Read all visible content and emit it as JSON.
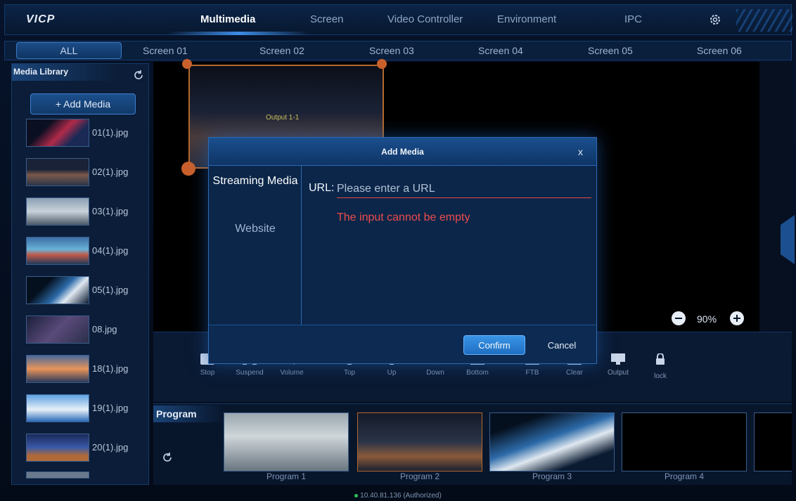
{
  "app": {
    "logo": "VICP"
  },
  "top_tabs": [
    {
      "label": "Multimedia",
      "active": true
    },
    {
      "label": "Screen"
    },
    {
      "label": "Video Controller"
    },
    {
      "label": "Environment"
    },
    {
      "label": "IPC"
    }
  ],
  "screen_tabs": [
    "ALL",
    "Screen 01",
    "Screen 02",
    "Screen 03",
    "Screen 04",
    "Screen 05",
    "Screen 06"
  ],
  "library": {
    "title": "Media Library",
    "add_label": "+ Add Media",
    "items": [
      "01(1).jpg",
      "02(1).jpg",
      "03(1).jpg",
      "04(1).jpg",
      "05(1).jpg",
      "08.jpg",
      "18(1).jpg",
      "19(1).jpg",
      "20(1).jpg"
    ]
  },
  "canvas": {
    "output_label": "Output 1-1",
    "zoom": "90%"
  },
  "toolbar": [
    "Stop",
    "Suspend",
    "Volume",
    "Top",
    "Up",
    "Down",
    "Bottom",
    "FTB",
    "Clear",
    "Output",
    "lock"
  ],
  "program": {
    "title": "Program",
    "items": [
      "Program 1",
      "Program 2",
      "Program 3",
      "Program 4"
    ]
  },
  "status": "10.40.81.136 (Authorized)",
  "modal": {
    "title": "Add Media",
    "close": "x",
    "nav": [
      "Streaming Media",
      "Website"
    ],
    "url_label": "URL:",
    "url_placeholder": "Please enter a URL",
    "url_value": "",
    "error": "The input cannot be empty",
    "confirm": "Confirm",
    "cancel": "Cancel"
  },
  "colors": {
    "accent": "#3a94e6",
    "error": "#ee4c4c",
    "output_frame": "#b4692c"
  }
}
